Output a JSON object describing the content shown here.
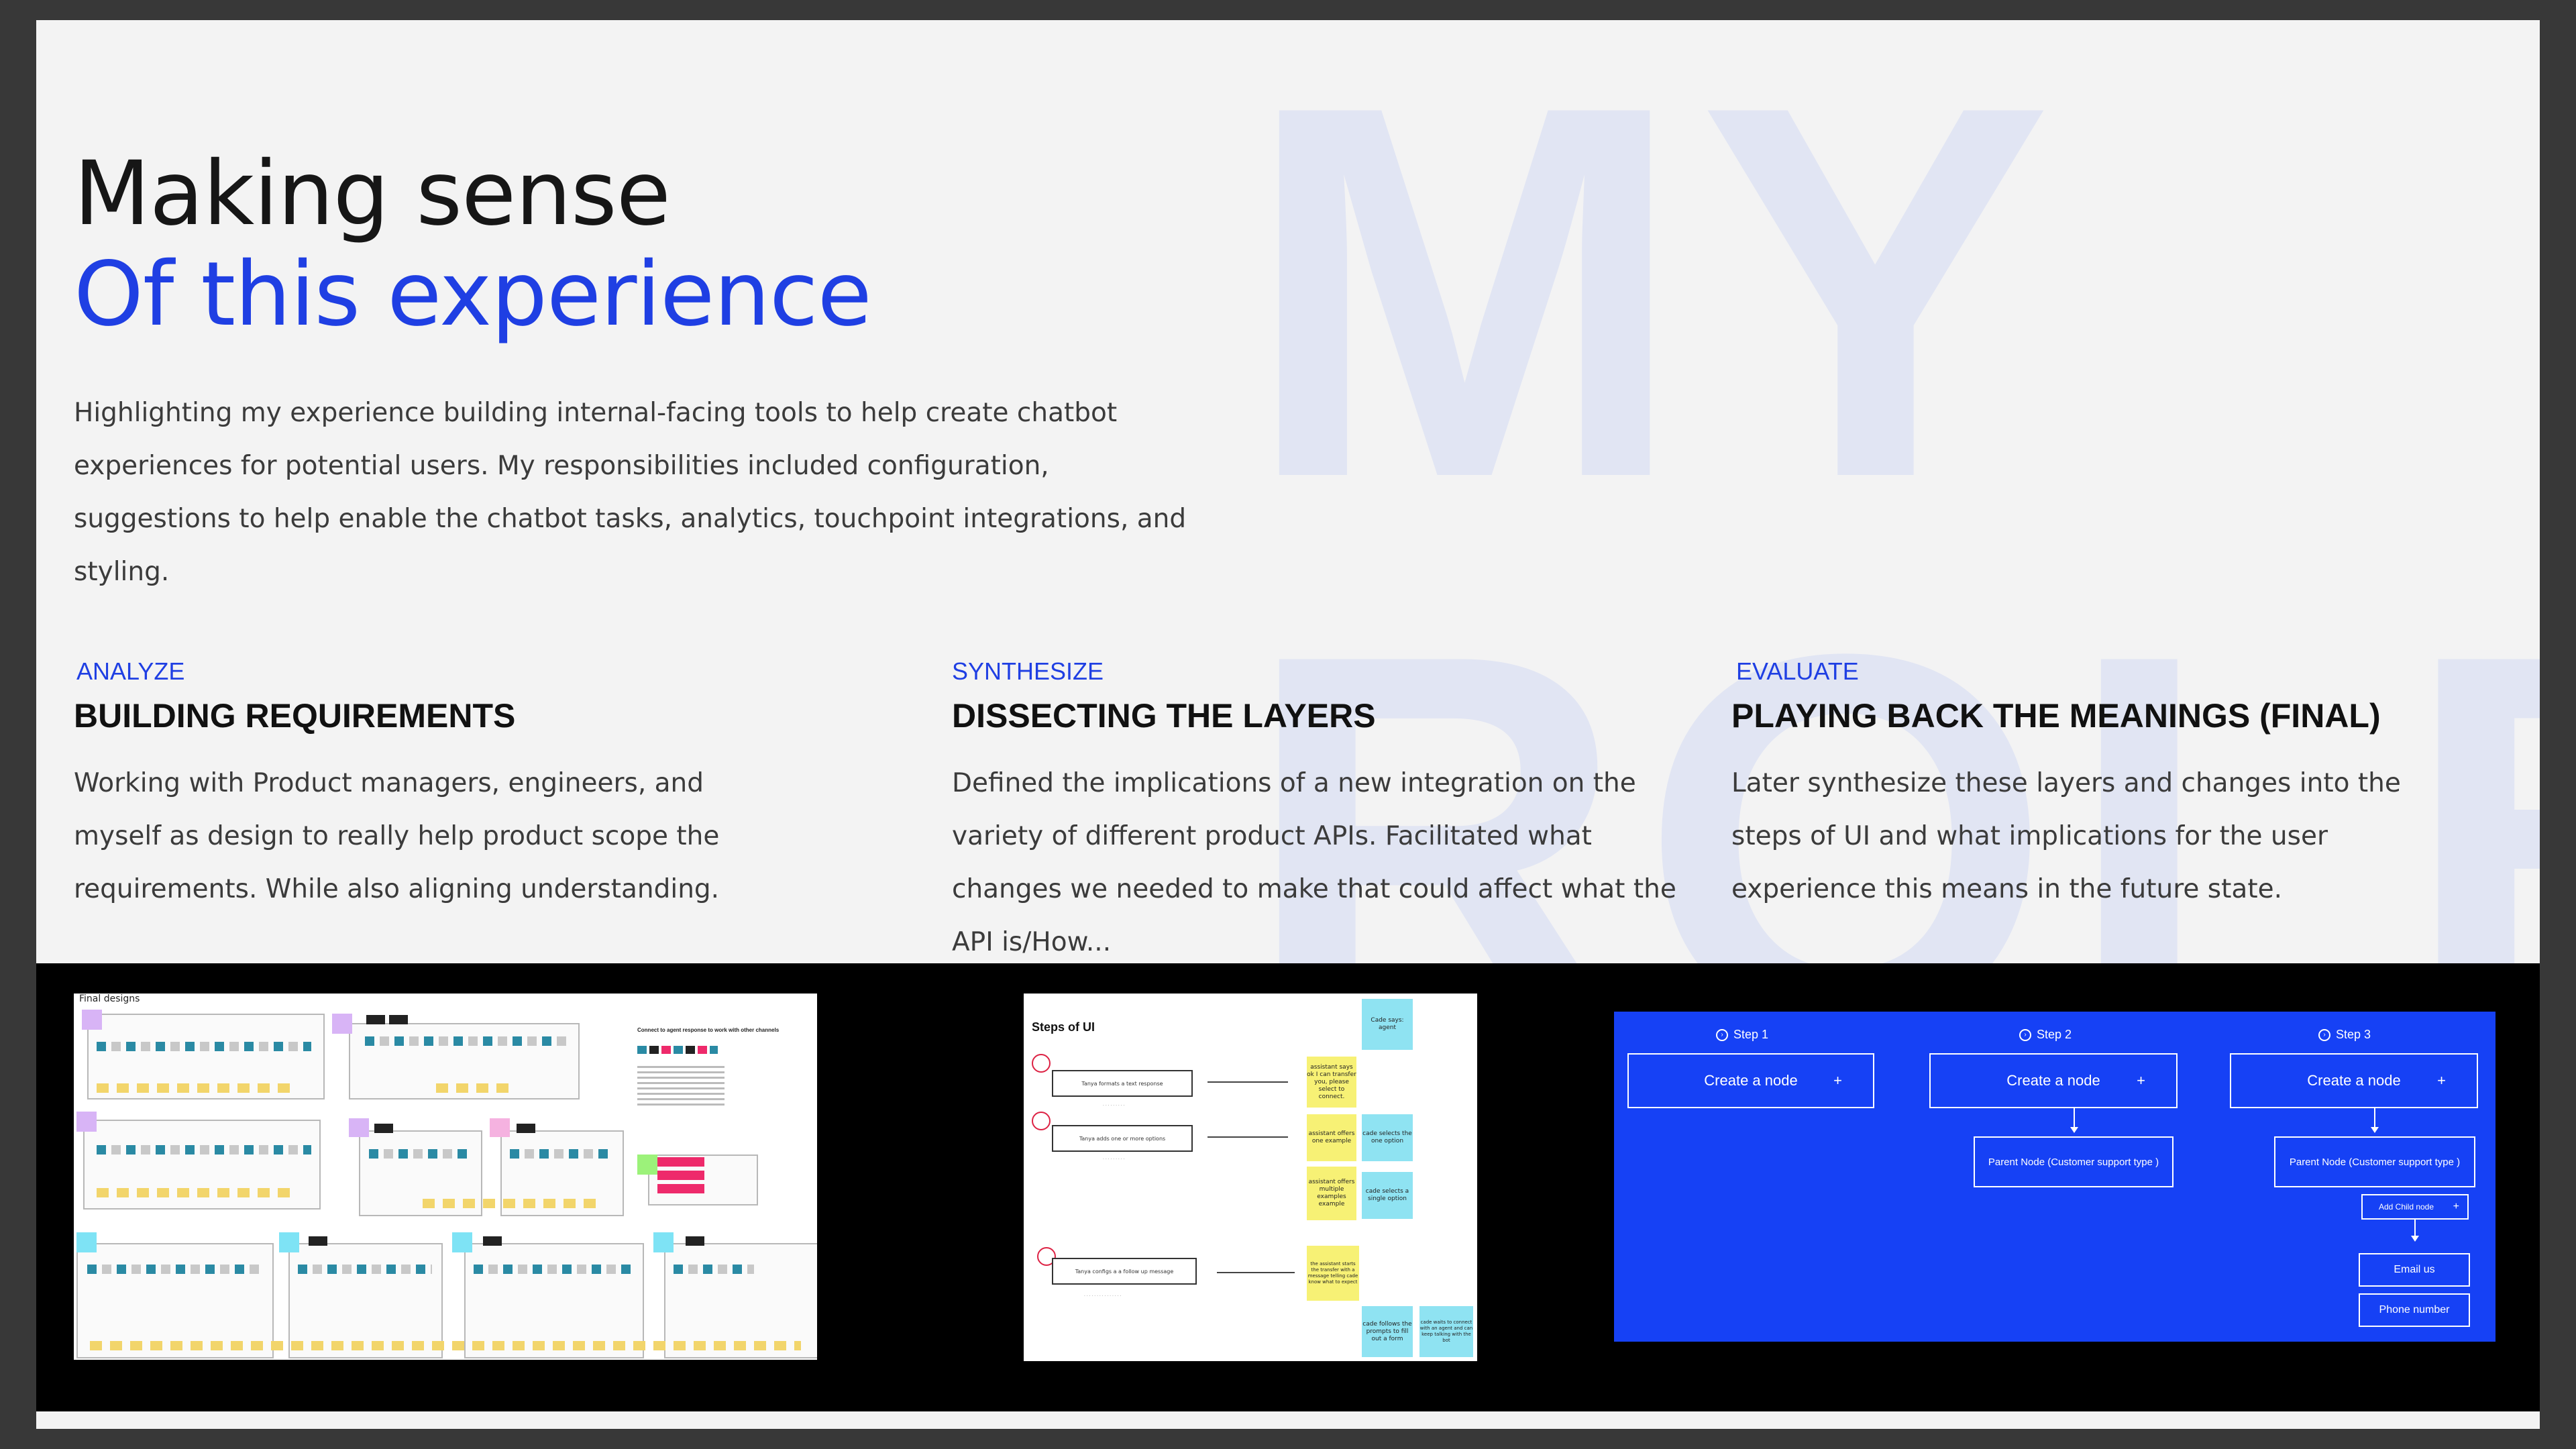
{
  "background_words": [
    "MY",
    "ROLE"
  ],
  "header": {
    "title_line1": "Making sense",
    "title_line2": "Of this experience",
    "intro": "Highlighting my experience building internal-facing tools to help create chatbot experiences for potential users. My responsibilities included configuration, suggestions to help enable the chatbot tasks, analytics, touchpoint integrations, and styling."
  },
  "columns": [
    {
      "eyebrow": "ANALYZE",
      "heading": "BUILDING REQUIREMENTS",
      "body": "Working with Product managers, engineers, and myself as design to really help product scope the requirements. While also aligning understanding."
    },
    {
      "eyebrow": "SYNTHESIZE",
      "heading": "DISSECTING THE LAYERS",
      "body": "Defined the implications of a new integration on the variety of different product APIs.  Facilitated what changes we needed to make that could affect what the API is/How..."
    },
    {
      "eyebrow": "EVALUATE",
      "heading": "PLAYING BACK THE MEANINGS (FINAL)",
      "body": "Later synthesize these layers and changes into the steps of UI and what implications for the user experience this means in the future state."
    }
  ],
  "thumbnails": {
    "final_designs": {
      "label": "Final designs",
      "side_note": "Connect to agent response to work with other channels"
    },
    "steps_of_ui": {
      "title": "Steps of UI",
      "flow_boxes": [
        "Tanya formats a text response",
        "Tanya adds one or more options",
        "Tanya configs a a follow up message"
      ],
      "notes": [
        "Cade says: agent",
        "assistant says ok I can transfer you, please select to connect.",
        "assistant offers one example",
        "cade selects the one option",
        "assistant offers multiple examples example",
        "cade selects a single option",
        "the assistant starts the transfer with a message telling cade know what to expect",
        "cade follows the prompts to fill out a form",
        "cade waits to connect with an agent and can keep talking with the bot"
      ]
    },
    "flow_steps": {
      "steps": [
        "Step 1",
        "Step 2",
        "Step 3"
      ],
      "create_node_label": "Create a node",
      "parent_node_label": "Parent Node (Customer support type )",
      "add_child_label": "Add Child node",
      "children": [
        "Email us",
        "Phone number"
      ],
      "plus": "+"
    }
  }
}
